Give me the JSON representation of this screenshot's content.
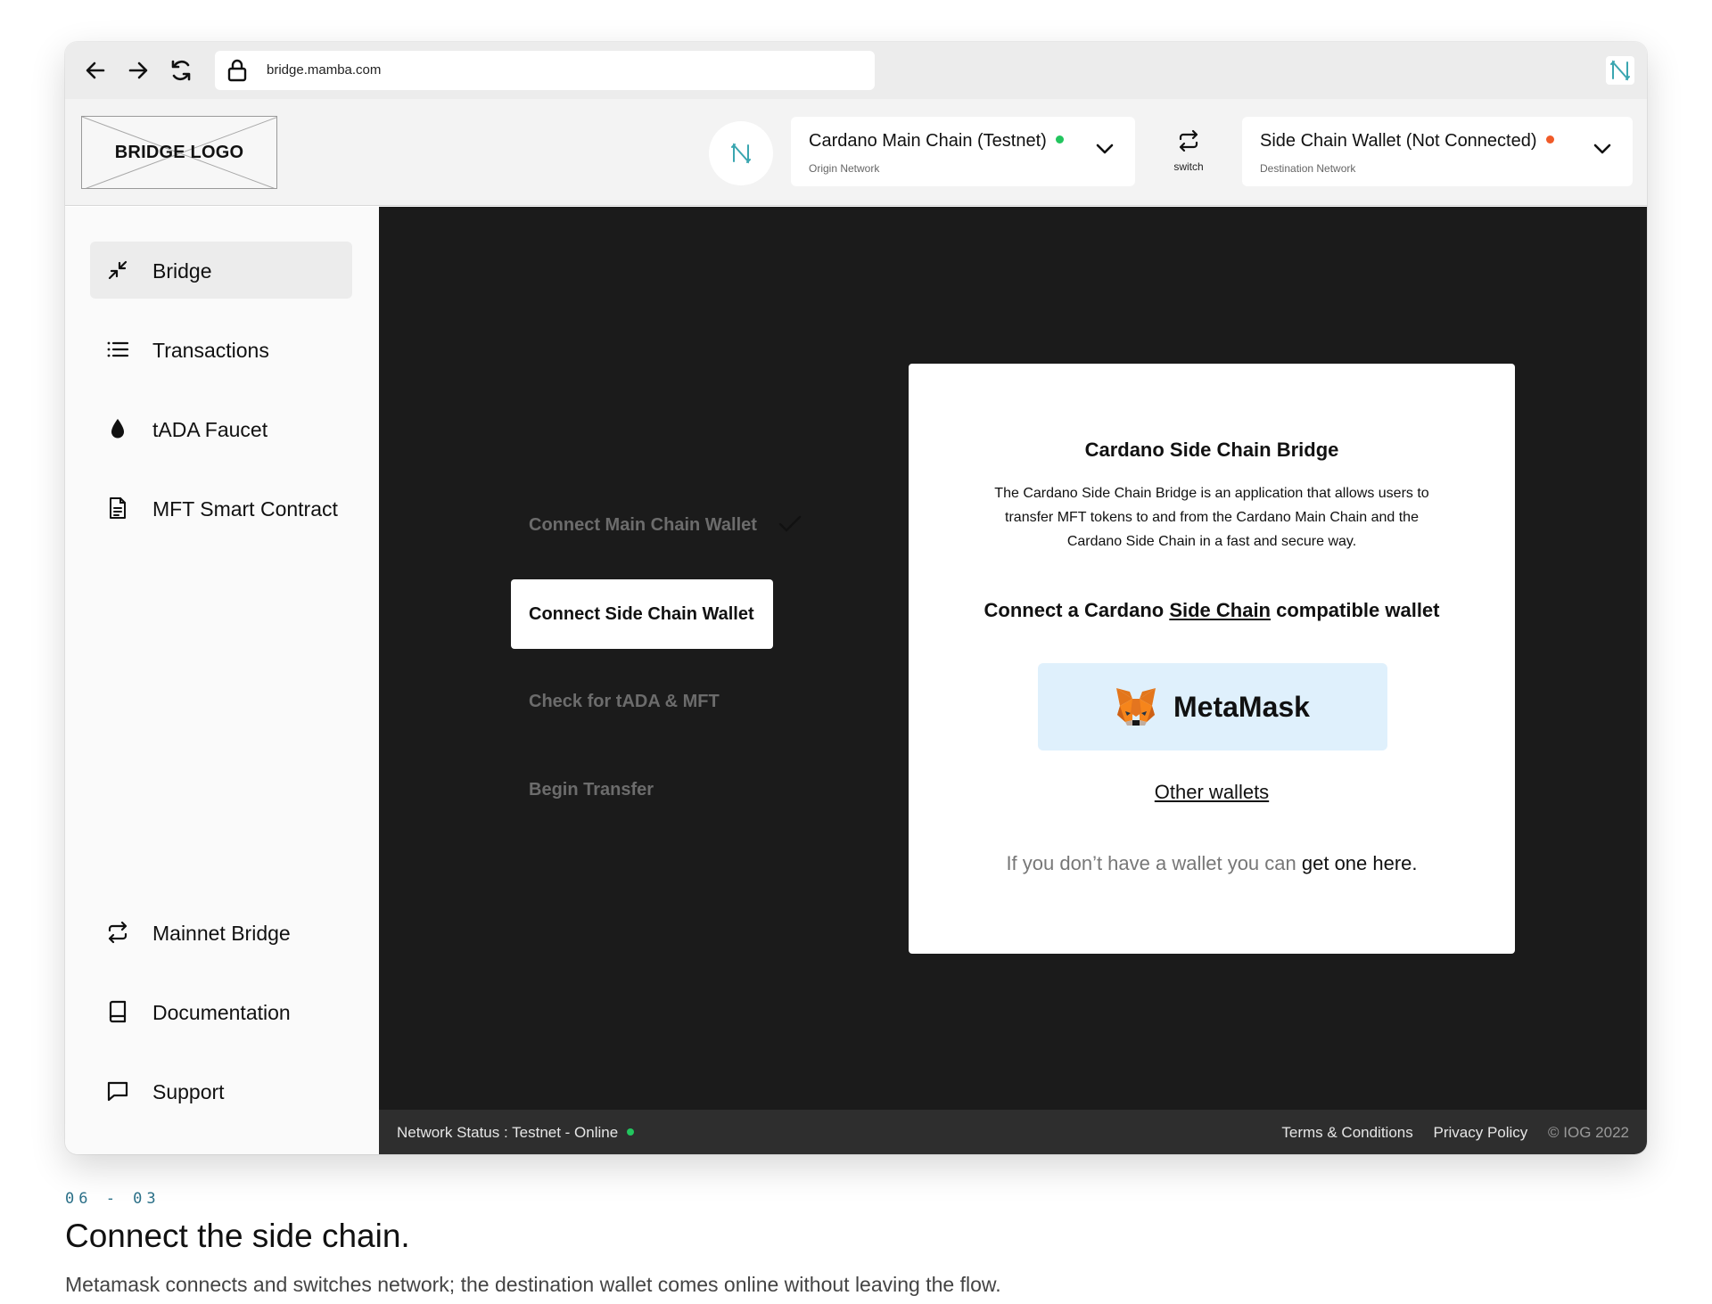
{
  "browser": {
    "url": "bridge.mamba.com"
  },
  "header": {
    "logo_text": "BRIDGE LOGO",
    "origin": {
      "title": "Cardano Main Chain (Testnet)",
      "subtitle": "Origin Network",
      "status_color": "#22c55e"
    },
    "switch_label": "switch",
    "destination": {
      "title": "Side Chain Wallet (Not Connected)",
      "subtitle": "Destination Network",
      "status_color": "#f05a28"
    }
  },
  "sidebar": {
    "items": [
      {
        "label": "Bridge",
        "icon": "minimize-arrows-icon",
        "active": true
      },
      {
        "label": "Transactions",
        "icon": "list-icon"
      },
      {
        "label": "tADA Faucet",
        "icon": "droplet-icon"
      },
      {
        "label": "MFT Smart Contract",
        "icon": "document-icon"
      }
    ],
    "bottom_items": [
      {
        "label": "Mainnet Bridge",
        "icon": "repeat-icon"
      },
      {
        "label": "Documentation",
        "icon": "book-icon"
      },
      {
        "label": "Support",
        "icon": "chat-icon"
      }
    ]
  },
  "steps": [
    {
      "label": "Connect Main Chain Wallet",
      "state": "done"
    },
    {
      "label": "Connect Side Chain Wallet",
      "state": "active"
    },
    {
      "label": "Check for tADA & MFT",
      "state": "pending"
    },
    {
      "label": "Begin Transfer",
      "state": "pending"
    }
  ],
  "card": {
    "title": "Cardano Side Chain Bridge",
    "description": "The Cardano Side Chain Bridge is an application that allows users to transfer MFT tokens to and from the Cardano Main Chain and the Cardano Side Chain in a fast and secure way.",
    "connect_prefix": "Connect a Cardano ",
    "connect_link": "Side Chain",
    "connect_suffix": " compatible wallet",
    "metamask_label": "MetaMask",
    "other_wallets": "Other wallets",
    "footer_prefix": "If you don’t have a wallet you can ",
    "footer_link": "get one here."
  },
  "status_bar": {
    "label": "Network Status : ",
    "value": " Testnet - Online",
    "status_color": "#22c55e",
    "terms": "Terms & Conditions",
    "privacy": "Privacy Policy",
    "copyright": "© IOG 2022"
  },
  "caption": {
    "id": "06 - 03",
    "title": "Connect the side chain.",
    "description": "Metamask connects and switches network; the destination wallet comes online without leaving the flow."
  }
}
